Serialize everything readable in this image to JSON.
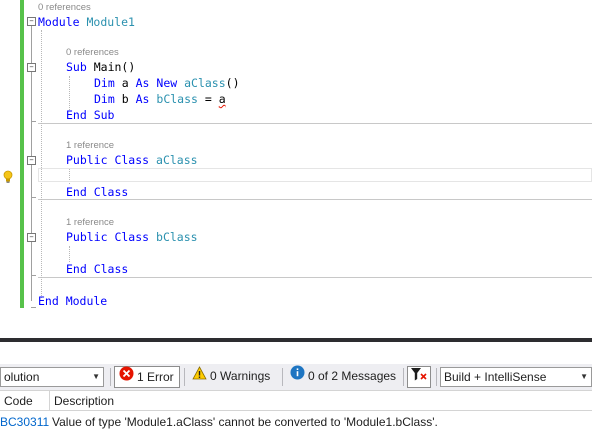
{
  "editor": {
    "ref_module": "0 references",
    "line_module": {
      "kw": "Module",
      "name": "Module1"
    },
    "ref_main": "0 references",
    "line_sub": {
      "kw": "Sub",
      "name": "Main()"
    },
    "line_dim_a": {
      "kw1": "Dim",
      "var": "a",
      "kw2": "As",
      "kw3": "New",
      "type": "aClass",
      "tail": "()"
    },
    "line_dim_b": {
      "kw1": "Dim",
      "var": "b",
      "kw2": "As",
      "type": "bClass",
      "eq": "=",
      "val": "a"
    },
    "line_end_sub": "End Sub",
    "ref_aclass": "1 reference",
    "line_aclass": {
      "kw": "Public Class",
      "name": "aClass"
    },
    "line_end_class_a": "End Class",
    "ref_bclass": "1 reference",
    "line_bclass": {
      "kw": "Public Class",
      "name": "bClass"
    },
    "line_end_class_b": "End Class",
    "line_end_module": "End Module",
    "collapse_glyph": "−",
    "lightbulb_icon": "lightbulb-icon"
  },
  "error_list": {
    "scope_combo": "olution",
    "errors_button": "1 Error",
    "warnings_button": "0 Warnings",
    "messages_button": "0 of 2 Messages",
    "filter_icon": "filter-icon",
    "build_combo": "Build + IntelliSense",
    "columns": {
      "code": "Code",
      "description": "Description"
    },
    "rows": [
      {
        "code": "BC30311",
        "description": "Value of type 'Module1.aClass' cannot be converted to 'Module1.bClass'."
      }
    ],
    "colors": {
      "error": "#e51400",
      "warning": "#ffcc00",
      "info": "#1e75c2",
      "code_link": "#0066cc"
    }
  }
}
